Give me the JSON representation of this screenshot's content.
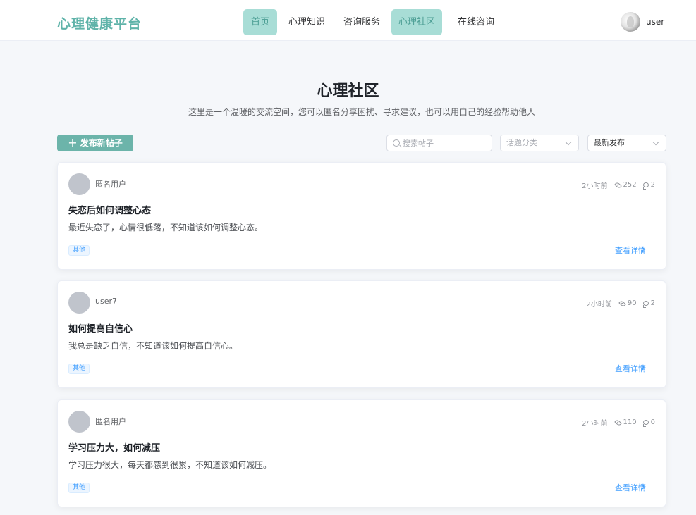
{
  "header": {
    "brand": "心理健康平台",
    "nav": [
      {
        "label": "首页",
        "active": true
      },
      {
        "label": "心理知识",
        "active": false
      },
      {
        "label": "咨询服务",
        "active": false
      },
      {
        "label": "心理社区",
        "active": true
      },
      {
        "label": "在线咨询",
        "active": false
      }
    ],
    "user_name": "user"
  },
  "page": {
    "title": "心理社区",
    "subtitle": "这里是一个温暖的交流空间，您可以匿名分享困扰、寻求建议，也可以用自己的经验帮助他人"
  },
  "toolbar": {
    "new_post_label": "发布新帖子",
    "search_placeholder": "搜索帖子",
    "category_placeholder": "话题分类",
    "sort_value": "最新发布"
  },
  "posts": [
    {
      "author": "匿名用户",
      "time": "2小时前",
      "views": "252",
      "comments": "2",
      "title": "失恋后如何调整心态",
      "content": "最近失恋了，心情很低落，不知道该如何调整心态。",
      "tag": "其他",
      "detail_label": "查看详情"
    },
    {
      "author": "user7",
      "time": "2小时前",
      "views": "90",
      "comments": "2",
      "title": "如何提高自信心",
      "content": "我总是缺乏自信，不知道该如何提高自信心。",
      "tag": "其他",
      "detail_label": "查看详情"
    },
    {
      "author": "匿名用户",
      "time": "2小时前",
      "views": "110",
      "comments": "0",
      "title": "学习压力大，如何减压",
      "content": "学习压力很大，每天都感到很累，不知道该如何减压。",
      "tag": "其他",
      "detail_label": "查看详情"
    }
  ],
  "colors": {
    "brand": "#5fb3a9",
    "nav_active_bg": "#a8ddd6",
    "primary_button": "#6cb4aa",
    "link": "#409eff",
    "page_bg": "#f5f7fa"
  }
}
